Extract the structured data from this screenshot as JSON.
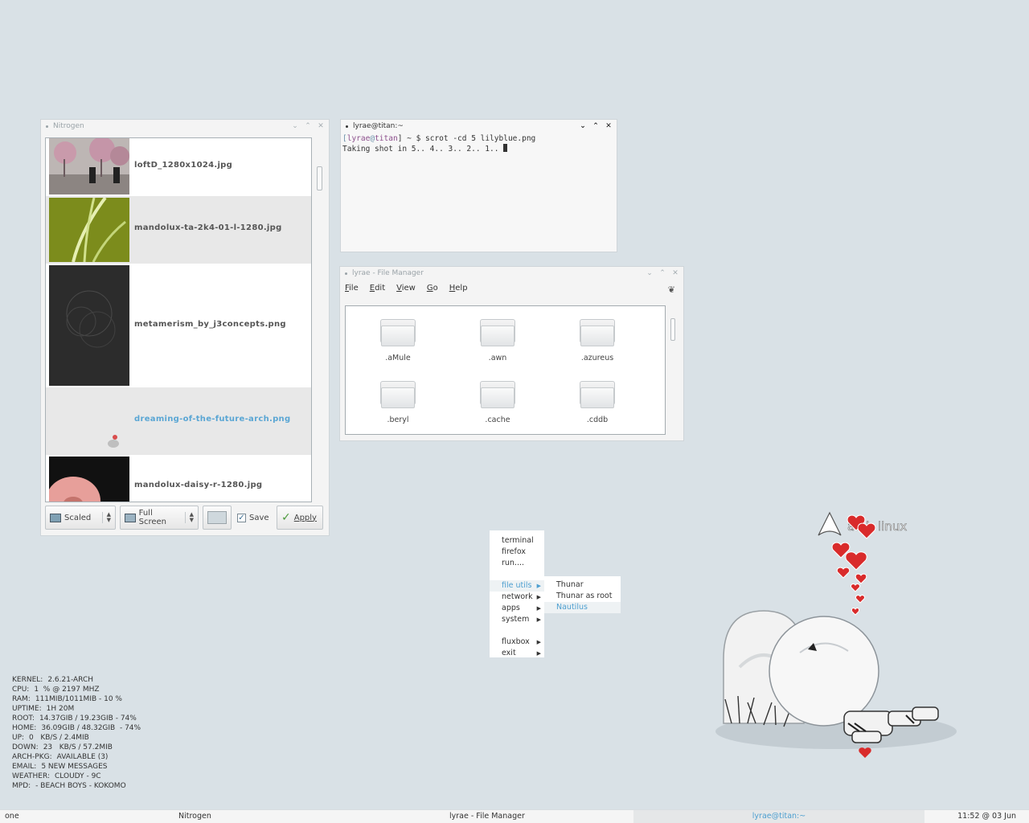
{
  "nitrogen": {
    "title": "Nitrogen",
    "files": [
      {
        "name": "loftD_1280x1024.jpg",
        "selected": false
      },
      {
        "name": "mandolux-ta-2k4-01-l-1280.jpg",
        "selected": false
      },
      {
        "name": "metamerism_by_j3concepts.png",
        "selected": false
      },
      {
        "name": "dreaming-of-the-future-arch.png",
        "selected": true
      },
      {
        "name": "mandolux-daisy-r-1280.jpg",
        "selected": false
      }
    ],
    "mode_select": "Scaled",
    "screen_select": "Full Screen",
    "save_label": "Save",
    "save_checked": true,
    "apply_label": "Apply"
  },
  "terminal": {
    "title": "lyrae@titan:~",
    "prompt_open": "[",
    "prompt_user": "lyrae",
    "prompt_at": "@",
    "prompt_host": "titan",
    "prompt_rest": "] ~ $ scrot -cd 5 lilyblue.png",
    "output": "Taking shot in 5.. 4.. 3.. 2.. 1.. "
  },
  "filemanager": {
    "title": "lyrae - File Manager",
    "menu": [
      {
        "key": "F",
        "rest": "ile"
      },
      {
        "key": "E",
        "rest": "dit"
      },
      {
        "key": "V",
        "rest": "iew"
      },
      {
        "key": "G",
        "rest": "o"
      },
      {
        "key": "H",
        "rest": "elp"
      }
    ],
    "folders": [
      ".aMule",
      ".awn",
      ".azureus",
      ".beryl",
      ".cache",
      ".cddb"
    ]
  },
  "rootmenu": {
    "items": [
      {
        "label": "terminal",
        "submenu": false
      },
      {
        "label": "firefox",
        "submenu": false
      },
      {
        "label": "run....",
        "submenu": false
      },
      {
        "label": "file utils",
        "submenu": true,
        "highlight": true
      },
      {
        "label": "network",
        "submenu": true
      },
      {
        "label": "apps",
        "submenu": true
      },
      {
        "label": "system",
        "submenu": true
      },
      {
        "label": "fluxbox",
        "submenu": true
      },
      {
        "label": "exit",
        "submenu": true
      }
    ],
    "submenu_items": [
      {
        "label": "Thunar"
      },
      {
        "label": "Thunar as root"
      },
      {
        "label": "Nautilus",
        "highlight": true
      }
    ]
  },
  "conky": [
    {
      "key": "KERNEL:",
      "value": "2.6.21-ARCH"
    },
    {
      "key": "CPU:",
      "value": "1  % @ 2197 MHZ"
    },
    {
      "key": "RAM:",
      "value": "111MIB/1011MIB - 10 %"
    },
    {
      "key": "UPTIME:",
      "value": "1H 20M"
    },
    {
      "key": "ROOT:",
      "value": "14.37GIB / 19.23GIB - 74%"
    },
    {
      "key": "HOME:",
      "value": "36.09GIB / 48.32GIB  - 74%"
    },
    {
      "key": "UP:",
      "value": "0   KB/S / 2.4MIB"
    },
    {
      "key": "DOWN:",
      "value": "23   KB/S / 57.2MIB"
    },
    {
      "key": "ARCH-PKG:",
      "value": "AVAILABLE (3)"
    },
    {
      "key": "EMAIL:",
      "value": "5 NEW MESSAGES"
    },
    {
      "key": "WEATHER:",
      "value": "CLOUDY - 9C"
    },
    {
      "key": "MPD:",
      "value": "- BEACH BOYS - KOKOMO"
    }
  ],
  "taskbar": {
    "workspace": "one",
    "tasks": [
      "Nitrogen",
      "lyrae - File Manager",
      "lyrae@titan:~"
    ],
    "clock": "11:52 @ 03 Jun"
  },
  "wallpaper_logo": {
    "part1": "arch",
    "part2": "linux"
  },
  "colors": {
    "accent": "#4d9fd0",
    "desktop": "#d9e1e6"
  }
}
